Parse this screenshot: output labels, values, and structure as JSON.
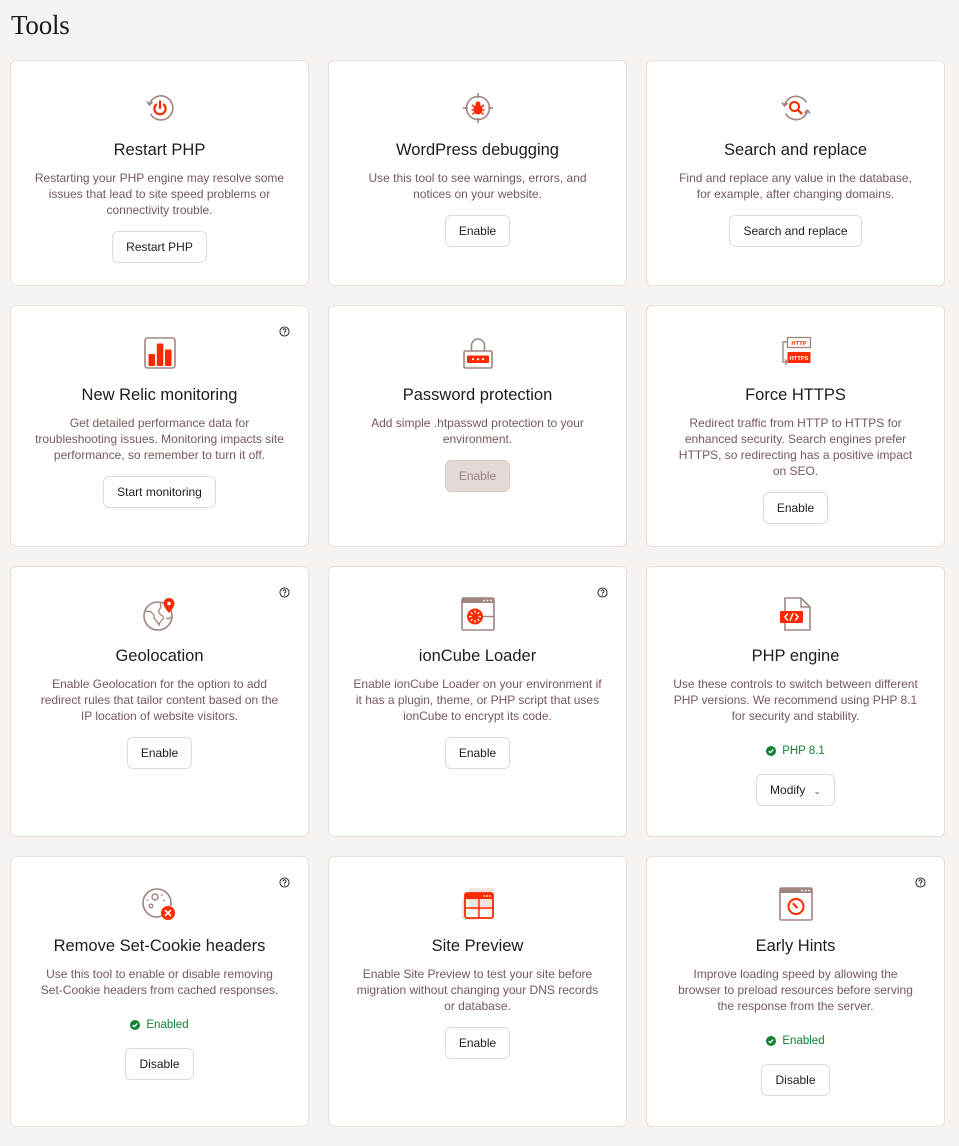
{
  "page": {
    "title": "Tools"
  },
  "colors": {
    "accent": "#ff2900",
    "muted_brown": "#a08580",
    "status_green": "#138232",
    "background": "#f7f3f0"
  },
  "cards": [
    {
      "title": "Restart PHP",
      "icon": "restart-power-icon",
      "description": "Restarting your PHP engine may resolve some issues that lead to site speed problems or connectivity trouble.",
      "button": "Restart PHP",
      "help": false
    },
    {
      "title": "WordPress debugging",
      "icon": "bug-target-icon",
      "description": "Use this tool to see warnings, errors, and notices on your website.",
      "button": "Enable",
      "help": false
    },
    {
      "title": "Search and replace",
      "icon": "search-replace-icon",
      "description": "Find and replace any value in the database, for example, after changing domains.",
      "button": "Search and replace",
      "help": false
    },
    {
      "title": "New Relic monitoring",
      "icon": "bar-chart-icon",
      "description": "Get detailed performance data for troubleshooting issues. Monitoring impacts site performance, so remember to turn it off.",
      "button": "Start monitoring",
      "help": true
    },
    {
      "title": "Password protection",
      "icon": "lock-password-icon",
      "description": "Add simple .htpasswd protection to your environment.",
      "button": "Enable",
      "button_disabled": true,
      "help": false
    },
    {
      "title": "Force HTTPS",
      "icon": "http-to-https-icon",
      "icon_labels": [
        "HTTP",
        "HTTPS"
      ],
      "description": "Redirect traffic from HTTP to HTTPS for enhanced security. Search engines prefer HTTPS, so redirecting has a positive impact on SEO.",
      "button": "Enable",
      "help": false
    },
    {
      "title": "Geolocation",
      "icon": "globe-pin-icon",
      "description": "Enable Geolocation for the option to add redirect rules that tailor content based on the IP location of website visitors.",
      "button": "Enable",
      "help": true
    },
    {
      "title": "ionCube Loader",
      "icon": "browser-loader-icon",
      "description": "Enable ionCube Loader on your environment if it has a plugin, theme, or PHP script that uses ionCube to encrypt its code.",
      "button": "Enable",
      "help": true
    },
    {
      "title": "PHP engine",
      "icon": "code-file-icon",
      "description": "Use these controls to switch between different PHP versions. We recommend using PHP 8.1 for security and stability.",
      "status": "PHP 8.1",
      "button": "Modify",
      "dropdown": true,
      "help": false
    },
    {
      "title": "Remove Set-Cookie headers",
      "icon": "cookie-remove-icon",
      "description": "Use this tool to enable or disable removing Set-Cookie headers from cached responses.",
      "status": "Enabled",
      "button": "Disable",
      "help": true
    },
    {
      "title": "Site Preview",
      "icon": "site-preview-icon",
      "description": "Enable Site Preview to test your site before migration without changing your DNS records or database.",
      "button": "Enable",
      "help": false
    },
    {
      "title": "Early Hints",
      "icon": "browser-gauge-icon",
      "description": "Improve loading speed by allowing the browser to preload resources before serving the response from the server.",
      "status": "Enabled",
      "button": "Disable",
      "help": true
    }
  ]
}
